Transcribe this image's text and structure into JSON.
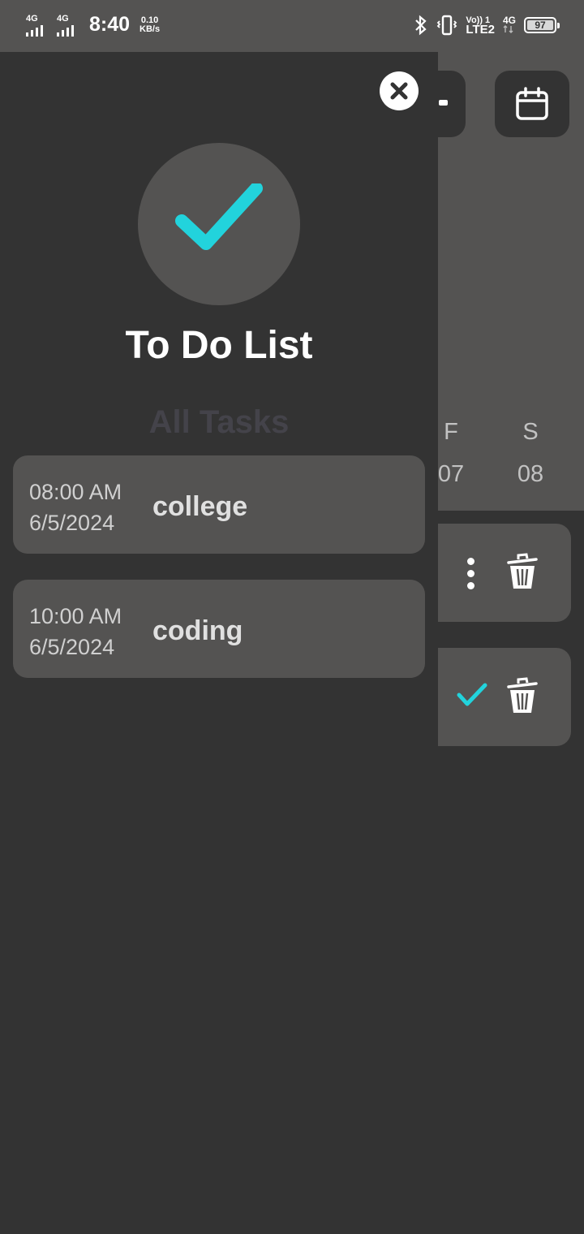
{
  "status_bar": {
    "sim1": "4G",
    "sim2": "4G",
    "time": "8:40",
    "speed_value": "0.10",
    "speed_unit": "KB/s",
    "volte": "Vo)) 1",
    "lte": "LTE2",
    "net": "4G",
    "battery": "97"
  },
  "drawer": {
    "title": "To Do List",
    "section_title": "All Tasks",
    "tasks": [
      {
        "time": "08:00 AM",
        "date": "6/5/2024",
        "name": "college"
      },
      {
        "time": "10:00 AM",
        "date": "6/5/2024",
        "name": "coding"
      }
    ]
  },
  "background": {
    "day_letters": [
      "F",
      "S"
    ],
    "day_numbers": [
      "07",
      "08"
    ]
  },
  "colors": {
    "accent": "#22d3dc",
    "surface": "#545352",
    "background": "#333333"
  },
  "icons": {
    "close": "close-icon",
    "logo": "checkmark-icon",
    "calendar": "calendar-icon",
    "more": "more-vertical-icon",
    "delete": "trash-icon",
    "done": "check-icon"
  }
}
